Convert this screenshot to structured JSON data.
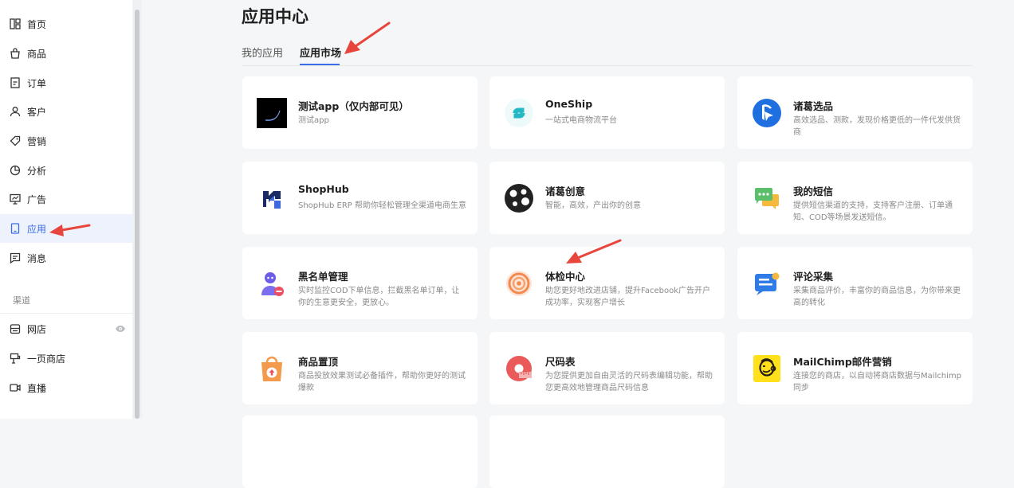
{
  "sidebar": {
    "items": [
      {
        "label": "首页",
        "icon": "dashboard-icon"
      },
      {
        "label": "商品",
        "icon": "shopping-bag-icon"
      },
      {
        "label": "订单",
        "icon": "order-icon"
      },
      {
        "label": "客户",
        "icon": "user-icon"
      },
      {
        "label": "营销",
        "icon": "tag-icon"
      },
      {
        "label": "分析",
        "icon": "pie-chart-icon"
      },
      {
        "label": "广告",
        "icon": "monitor-icon"
      },
      {
        "label": "应用",
        "icon": "tablet-icon",
        "active": true
      },
      {
        "label": "消息",
        "icon": "message-icon"
      }
    ],
    "section_label": "渠道",
    "channel_items": [
      {
        "label": "网店",
        "icon": "store-icon"
      },
      {
        "label": "一页商店",
        "icon": "one-page-store-icon"
      },
      {
        "label": "直播",
        "icon": "video-icon"
      }
    ],
    "accent_color": "#3b6de8"
  },
  "main": {
    "title": "应用中心",
    "tabs": [
      {
        "label": "我的应用",
        "active": false
      },
      {
        "label": "应用市场",
        "active": true
      }
    ],
    "cards": [
      {
        "title": "测试app（仅内部可见）",
        "desc": "测试app",
        "icon": "test-app-icon"
      },
      {
        "title": "OneShip",
        "desc": "一站式电商物流平台",
        "icon": "oneship-icon"
      },
      {
        "title": "诸葛选品",
        "desc": "高效选品、测款，发现价格更低的一件代发供货商",
        "icon": "zhuge-product-icon"
      },
      {
        "title": "ShopHub",
        "desc": "ShopHub ERP 帮助你轻松管理全渠道电商生意",
        "icon": "shophub-icon"
      },
      {
        "title": "诸葛创意",
        "desc": "智能，高效，产出你的创意",
        "icon": "zhuge-creative-icon"
      },
      {
        "title": "我的短信",
        "desc": "提供短信渠道的支持，支持客户注册、订单通知、COD等场景发送短信。",
        "icon": "sms-icon"
      },
      {
        "title": "黑名单管理",
        "desc": "实时监控COD下单信息，拦截黑名单订单，让你的生意更安全，更放心。",
        "icon": "blacklist-icon"
      },
      {
        "title": "体检中心",
        "desc": "助您更好地改进店铺，提升Facebook广告开户成功率，实现客户增长",
        "icon": "health-check-icon"
      },
      {
        "title": "评论采集",
        "desc": "采集商品评价，丰富你的商品信息，为你带来更高的转化",
        "icon": "review-collect-icon"
      },
      {
        "title": "商品置顶",
        "desc": "商品投放效果测试必备插件，帮助你更好的测试爆款",
        "icon": "product-pin-icon"
      },
      {
        "title": "尺码表",
        "desc": "为您提供更加自由灵活的尺码表编辑功能，帮助您更高效地管理商品尺码信息",
        "icon": "size-chart-icon"
      },
      {
        "title": "MailChimp邮件营销",
        "desc": "连接您的商店，以自动将商店数据与Mailchimp同步",
        "icon": "mailchimp-icon"
      }
    ]
  }
}
